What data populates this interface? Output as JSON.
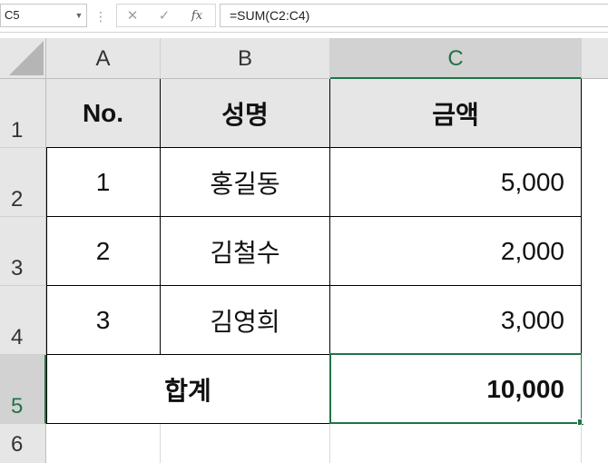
{
  "formula_bar": {
    "name_box": "C5",
    "cancel_icon": "✕",
    "enter_icon": "✓",
    "fx_label": "fx",
    "formula": "=SUM(C2:C4)"
  },
  "grid": {
    "columns": [
      "A",
      "B",
      "C"
    ],
    "rows": [
      "1",
      "2",
      "3",
      "4",
      "5",
      "6"
    ],
    "selected_column": "C",
    "selected_row": "5"
  },
  "table": {
    "headers": [
      "No.",
      "성명",
      "금액"
    ],
    "rows": [
      {
        "no": "1",
        "name": "홍길동",
        "amount": "5,000"
      },
      {
        "no": "2",
        "name": "김철수",
        "amount": "2,000"
      },
      {
        "no": "3",
        "name": "김영희",
        "amount": "3,000"
      }
    ],
    "total_label": "합계",
    "total_amount": "10,000"
  },
  "colors": {
    "selection": "#217346",
    "header_bg": "#e6e6e6"
  }
}
